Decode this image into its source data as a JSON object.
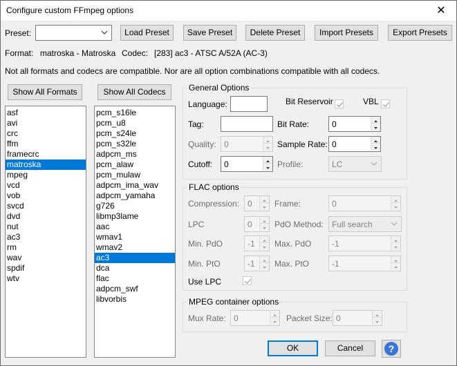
{
  "window": {
    "title": "Configure custom FFmpeg options",
    "close_glyph": "✕"
  },
  "preset": {
    "label": "Preset:",
    "value": "",
    "buttons": [
      "Load Preset",
      "Save Preset",
      "Delete Preset",
      "Import Presets",
      "Export Presets"
    ]
  },
  "info": {
    "format_label": "Format:",
    "format_value": "matroska - Matroska",
    "codec_label": "Codec:",
    "codec_value": "[283] ac3 - ATSC A/52A (AC-3)",
    "notice": "Not all formats and codecs are compatible. Nor are all option combinations compatible with all codecs."
  },
  "show_all_formats": "Show All Formats",
  "show_all_codecs": "Show All Codecs",
  "formats": [
    "asf",
    "avi",
    "crc",
    "ffm",
    "framecrc",
    "matroska",
    "mpeg",
    "vcd",
    "vob",
    "svcd",
    "dvd",
    "nut",
    "ac3",
    "rm",
    "wav",
    "spdif",
    "wtv"
  ],
  "formats_selected": "matroska",
  "codecs": [
    "pcm_s16le",
    "pcm_u8",
    "pcm_s24le",
    "pcm_s32le",
    "adpcm_ms",
    "pcm_alaw",
    "pcm_mulaw",
    "adpcm_ima_wav",
    "adpcm_yamaha",
    "g726",
    "libmp3lame",
    "aac",
    "wmav1",
    "wmav2",
    "ac3",
    "dca",
    "flac",
    "adpcm_swf",
    "libvorbis"
  ],
  "codecs_selected": "ac3",
  "general": {
    "title": "General Options",
    "language_label": "Language:",
    "language_value": "",
    "bit_reservoir_label": "Bit Reservoir",
    "bit_reservoir_checked": true,
    "vbl_label": "VBL",
    "vbl_checked": true,
    "tag_label": "Tag:",
    "tag_value": "",
    "bit_rate_label": "Bit Rate:",
    "bit_rate_value": "0",
    "quality_label": "Quality:",
    "quality_value": "0",
    "sample_rate_label": "Sample Rate:",
    "sample_rate_value": "0",
    "cutoff_label": "Cutoff:",
    "cutoff_value": "0",
    "profile_label": "Profile:",
    "profile_value": "LC"
  },
  "flac": {
    "title": "FLAC options",
    "compression_label": "Compression:",
    "compression_value": "0",
    "frame_label": "Frame:",
    "frame_value": "0",
    "lpc_label": "LPC",
    "lpc_value": "0",
    "pdo_method_label": "PdO Method:",
    "pdo_method_value": "Full search",
    "min_pdo_label": "Min. PdO",
    "min_pdo_value": "-1",
    "max_pdo_label": "Max. PdO",
    "max_pdo_value": "-1",
    "min_pto_label": "Min. PtO",
    "min_pto_value": "-1",
    "max_pto_label": "Max. PtO",
    "max_pto_value": "-1",
    "use_lpc_label": "Use LPC",
    "use_lpc_checked": true
  },
  "mpeg": {
    "title": "MPEG container options",
    "mux_rate_label": "Mux Rate:",
    "mux_rate_value": "0",
    "packet_size_label": "Packet Size:",
    "packet_size_value": "0"
  },
  "footer": {
    "ok": "OK",
    "cancel": "Cancel",
    "help_glyph": "?"
  }
}
